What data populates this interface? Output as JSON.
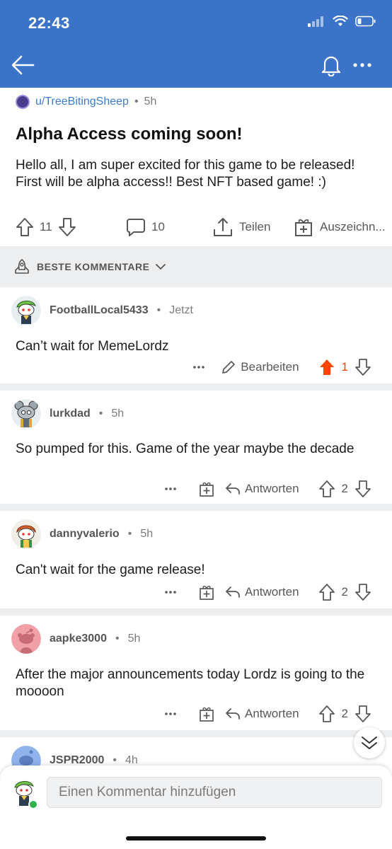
{
  "status": {
    "time": "22:43"
  },
  "post": {
    "author": "u/TreeBitingSheep",
    "time": "5h",
    "title": "Alpha Access coming soon!",
    "body": "Hello all, I am super excited for this game to be released! First will be alpha access!! Best NFT based game! :)",
    "votes": "11",
    "comments": "10",
    "share_label": "Teilen",
    "award_label": "Auszeichn..."
  },
  "sort": {
    "label": "BESTE KOMMENTARE"
  },
  "comments": [
    {
      "user": "FootballLocal5433",
      "time": "Jetzt",
      "text": "Can’t wait for MemeLordz",
      "action": "Bearbeiten",
      "votes": "1"
    },
    {
      "user": "lurkdad",
      "time": "5h",
      "text": "So pumped for this. Game of the year maybe the decade",
      "action": "Antworten",
      "votes": "2"
    },
    {
      "user": "dannyvalerio",
      "time": "5h",
      "text": "Can't wait for the game release!",
      "action": "Antworten",
      "votes": "2"
    },
    {
      "user": "aapke3000",
      "time": "5h",
      "text": "After the major announcements today Lordz is going to the moooon",
      "action": "Antworten",
      "votes": "2"
    },
    {
      "user": "JSPR2000",
      "time": "4h"
    }
  ],
  "composer": {
    "placeholder": "Einen Kommentar hinzufügen"
  },
  "colors": {
    "header": "#3b73c8",
    "upvote_active": "#ff4500",
    "link": "#3f7bcc"
  }
}
